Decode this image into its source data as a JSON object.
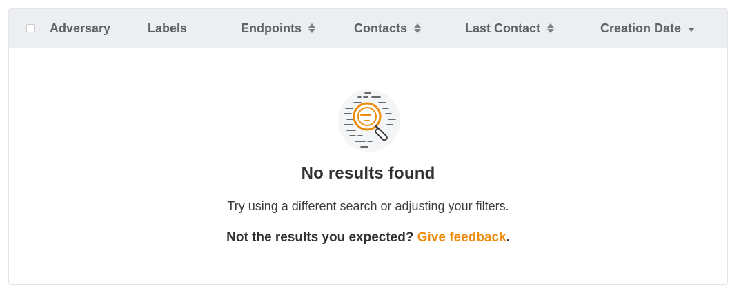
{
  "table": {
    "columns": [
      {
        "label": "Adversary",
        "sort": "none"
      },
      {
        "label": "Labels",
        "sort": "none"
      },
      {
        "label": "Endpoints",
        "sort": "sortable"
      },
      {
        "label": "Contacts",
        "sort": "sortable"
      },
      {
        "label": "Last Contact",
        "sort": "sortable"
      },
      {
        "label": "Creation Date",
        "sort": "descending"
      }
    ],
    "select_all_checked": false
  },
  "empty_state": {
    "icon": "magnifier-search-icon",
    "title": "No results found",
    "description": "Try using a different search or adjusting your filters.",
    "feedback_prompt": "Not the results you expected?",
    "feedback_link": "Give feedback",
    "feedback_suffix": "."
  },
  "colors": {
    "accent": "#ee8c0f",
    "header_bg": "#eceeef",
    "header_text": "#5e6166",
    "title_text": "#2f3133"
  }
}
